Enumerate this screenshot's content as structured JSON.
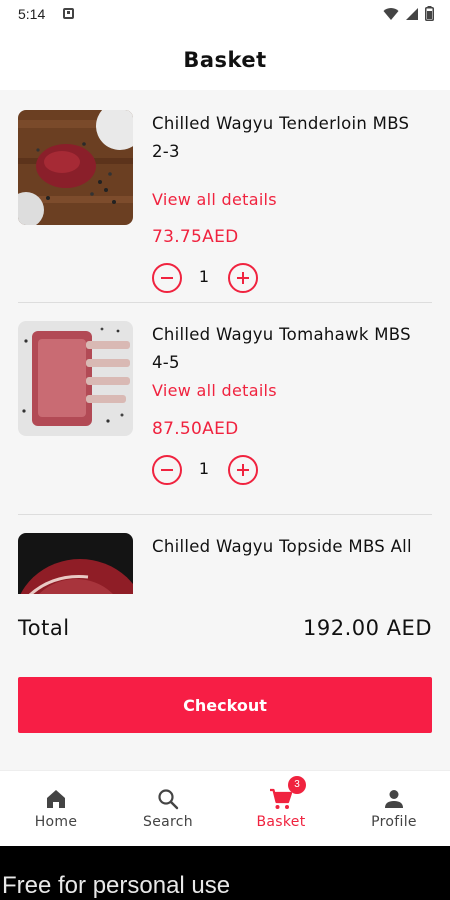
{
  "status_bar": {
    "time": "5:14",
    "icons": [
      "notification-icon",
      "wifi-icon",
      "signal-icon",
      "battery-icon"
    ]
  },
  "header": {
    "title": "Basket"
  },
  "basket": {
    "items": [
      {
        "name": "Chilled Wagyu Tenderloin MBS 2-3",
        "details_link": "View all details",
        "price": "73.75AED",
        "quantity": "1",
        "image": "wagyu-tenderloin-photo"
      },
      {
        "name": "Chilled Wagyu Tomahawk MBS 4-5",
        "details_link": "View all details",
        "price": "87.50AED",
        "quantity": "1",
        "image": "wagyu-tomahawk-photo"
      },
      {
        "name": "Chilled Wagyu Topside MBS All",
        "image": "wagyu-topside-photo"
      }
    ]
  },
  "summary": {
    "total_label": "Total",
    "total_value": "192.00 AED"
  },
  "checkout": {
    "label": "Checkout"
  },
  "bottom_nav": {
    "items": [
      {
        "label": "Home",
        "icon": "home-icon"
      },
      {
        "label": "Search",
        "icon": "search-icon"
      },
      {
        "label": "Basket",
        "icon": "cart-icon",
        "badge": "3",
        "active": true
      },
      {
        "label": "Profile",
        "icon": "profile-icon"
      }
    ]
  },
  "watermark": {
    "text": "Free for personal use"
  },
  "colors": {
    "accent": "#f0233f",
    "checkout_button": "#f71e45",
    "background": "#f6f6f6"
  }
}
